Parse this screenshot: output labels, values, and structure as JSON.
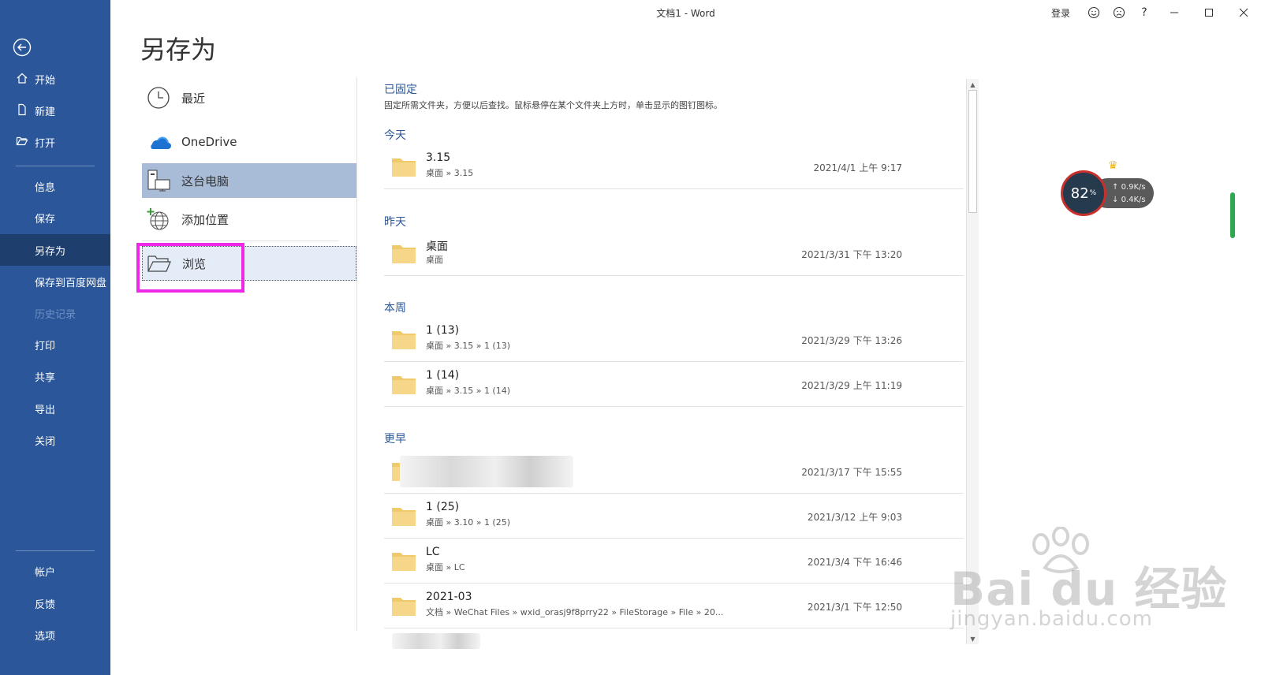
{
  "window": {
    "title": "文档1  -  Word",
    "login": "登录",
    "help": "?"
  },
  "nav": {
    "items": [
      {
        "label": "开始",
        "icon": "home-icon"
      },
      {
        "label": "新建",
        "icon": "new-document-icon"
      },
      {
        "label": "打开",
        "icon": "open-folder-icon"
      },
      {
        "label": "信息"
      },
      {
        "label": "保存"
      },
      {
        "label": "另存为",
        "active": true
      },
      {
        "label": "保存到百度网盘"
      },
      {
        "label": "历史记录",
        "disabled": true
      },
      {
        "label": "打印"
      },
      {
        "label": "共享"
      },
      {
        "label": "导出"
      },
      {
        "label": "关闭"
      }
    ],
    "bottom": [
      {
        "label": "帐户"
      },
      {
        "label": "反馈"
      },
      {
        "label": "选项"
      }
    ]
  },
  "page": {
    "title": "另存为"
  },
  "locations": [
    {
      "label": "最近",
      "icon": "clock-icon"
    },
    {
      "label": "OneDrive",
      "icon": "onedrive-cloud-icon"
    },
    {
      "label": "这台电脑",
      "icon": "this-pc-icon",
      "selected": true
    },
    {
      "label": "添加位置",
      "icon": "add-location-globe-icon"
    },
    {
      "label": "浏览",
      "icon": "browse-folder-icon"
    }
  ],
  "pinned": {
    "heading": "已固定",
    "description": "固定所需文件夹，方便以后查找。鼠标悬停在某个文件夹上方时，单击显示的图钉图标。"
  },
  "groups": {
    "today": "今天",
    "yesterday": "昨天",
    "this_week": "本周",
    "earlier": "更早"
  },
  "folders": {
    "today": [
      {
        "name": "3.15",
        "path": "桌面 » 3.15",
        "date": "2021/4/1 上午 9:17"
      }
    ],
    "yesterday": [
      {
        "name": "桌面",
        "path": "桌面",
        "date": "2021/3/31 下午 13:20"
      }
    ],
    "this_week": [
      {
        "name": "1 (13)",
        "path": "桌面 » 3.15 » 1 (13)",
        "date": "2021/3/29 下午 13:26"
      },
      {
        "name": "1 (14)",
        "path": "桌面 » 3.15 » 1 (14)",
        "date": "2021/3/29 上午 11:19"
      }
    ],
    "earlier": [
      {
        "name": "",
        "path": "",
        "date": "2021/3/17 下午 15:55"
      },
      {
        "name": "1 (25)",
        "path": "桌面 » 3.10 » 1 (25)",
        "date": "2021/3/12 上午 9:03"
      },
      {
        "name": "LC",
        "path": "桌面 » LC",
        "date": "2021/3/4 下午 16:46"
      },
      {
        "name": "2021-03",
        "path": "文档 » WeChat Files » wxid_orasj9f8prry22 » FileStorage » File » 20...",
        "date": "2021/3/1 下午 12:50"
      }
    ]
  },
  "speed_widget": {
    "percent": "82",
    "percent_sign": "%",
    "upload": "0.9K/s",
    "download": "0.4K/s"
  },
  "watermark": {
    "brand": "Bai du 经验",
    "url": "jingyan.baidu.com"
  },
  "colors": {
    "nav_bg": "#2b579a",
    "nav_active": "#1e3e6e",
    "selected_location": "#a8bcd8",
    "highlight_border": "#ee28e6",
    "folder": "#f0c96b"
  }
}
